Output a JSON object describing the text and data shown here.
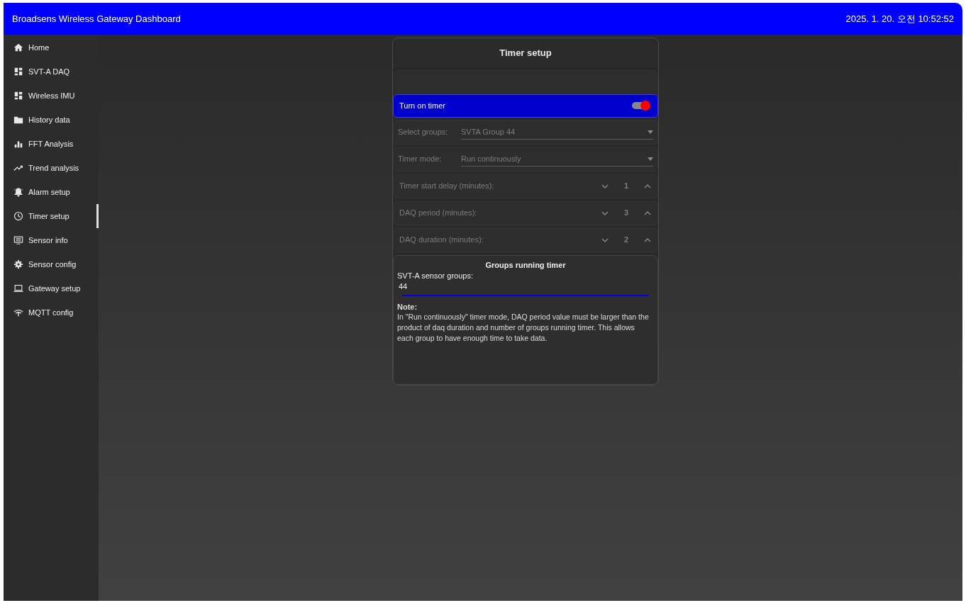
{
  "header": {
    "title": "Broadsens Wireless Gateway Dashboard",
    "datetime": "2025. 1. 20. 오전 10:52:52"
  },
  "sidebar": {
    "items": [
      {
        "label": "Home",
        "kind": "home",
        "selected": false
      },
      {
        "label": "SVT-A DAQ",
        "kind": "dashboard",
        "selected": false
      },
      {
        "label": "Wireless IMU",
        "kind": "dashboard",
        "selected": false
      },
      {
        "label": "History data",
        "kind": "folder",
        "selected": false
      },
      {
        "label": "FFT Analysis",
        "kind": "bars",
        "selected": false
      },
      {
        "label": "Trend analysis",
        "kind": "trend",
        "selected": false
      },
      {
        "label": "Alarm setup",
        "kind": "alarm",
        "selected": false
      },
      {
        "label": "Timer setup",
        "kind": "clock",
        "selected": true
      },
      {
        "label": "Sensor info",
        "kind": "monitor",
        "selected": false
      },
      {
        "label": "Sensor config",
        "kind": "gear",
        "selected": false
      },
      {
        "label": "Gateway setup",
        "kind": "laptop",
        "selected": false
      },
      {
        "label": "MQTT config",
        "kind": "signal",
        "selected": false
      }
    ]
  },
  "card": {
    "title": "Timer setup",
    "toggle": {
      "label": "Turn on timer",
      "on": true
    },
    "fields": [
      {
        "kind": "select",
        "label": "Select groups:",
        "value": "SVTA Group 44",
        "disabled": true
      },
      {
        "kind": "select",
        "label": "Timer mode:",
        "value": "Run continuously",
        "disabled": true
      },
      {
        "kind": "stepper",
        "label": "Timer start delay (minutes):",
        "value": "1",
        "disabled": true
      },
      {
        "kind": "stepper",
        "label": "DAQ period (minutes):",
        "value": "3",
        "disabled": true
      },
      {
        "kind": "stepper",
        "label": "DAQ duration (minutes):",
        "value": "2",
        "disabled": true
      }
    ],
    "groups": {
      "title": "Groups running timer",
      "label": "SVT-A sensor groups:",
      "value": "44",
      "note_title": "Note:",
      "note": "In \"Run continuously\" timer mode, DAQ period value must be larger than the product of daq duration and number of groups running timer. This allows each group to have enough time to take data."
    }
  }
}
